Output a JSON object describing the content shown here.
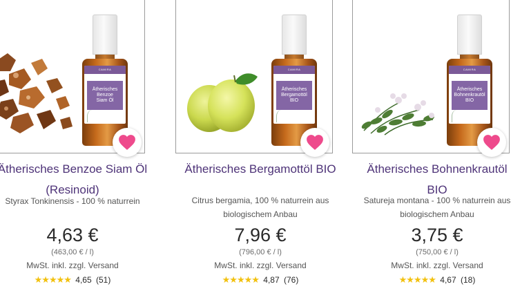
{
  "products": [
    {
      "title_line1": "Ätherisches Benzoe Siam Öl",
      "title_line2": "(Resinoid)",
      "subtitle_line1": "Styrax Tonkinensis - 100 % naturrein",
      "subtitle_line2": "",
      "price": "4,63 €",
      "unit_price": "(463,00 € / l)",
      "vat": "MwSt. inkl. zzgl. Versand",
      "stars": "★★★★★",
      "rating": "4,65",
      "reviews": "(51)",
      "bottle_label": [
        "Ätherisches",
        "Benzoe",
        "Siam Öl"
      ],
      "brand": "CAMIRA",
      "image_subject": "benzoin-resin-chunks"
    },
    {
      "title_line1": "Ätherisches Bergamottöl BIO",
      "title_line2": "",
      "subtitle_line1": "Citrus bergamia, 100 % naturrein aus",
      "subtitle_line2": "biologischem Anbau",
      "price": "7,96 €",
      "unit_price": "(796,00 € / l)",
      "vat": "MwSt. inkl. zzgl. Versand",
      "stars": "★★★★★",
      "rating": "4,87",
      "reviews": "(76)",
      "bottle_label": [
        "Ätherisches",
        "Bergamottöl",
        "BIO"
      ],
      "brand": "CAMIRA",
      "image_subject": "bergamot-fruits"
    },
    {
      "title_line1": "Ätherisches Bohnenkrautöl",
      "title_line2": "BIO",
      "subtitle_line1": "Satureja montana - 100 % naturrein aus",
      "subtitle_line2": "biologischem Anbau",
      "price": "3,75 €",
      "unit_price": "(750,00 € / l)",
      "vat": "MwSt. inkl. zzgl. Versand",
      "stars": "★★★★★",
      "rating": "4,67",
      "reviews": "(18)",
      "bottle_label": [
        "Ätherisches",
        "Bohnenkrautöl",
        "BIO"
      ],
      "brand": "CAMIRA",
      "image_subject": "savory-herb-sprigs"
    }
  ],
  "colors": {
    "title": "#4e3378",
    "heart": "#ee4a8c",
    "star": "#f2c10f",
    "label_purple": "#8466a5"
  },
  "icons": {
    "wishlist": "heart-icon",
    "rating": "star-icon"
  }
}
